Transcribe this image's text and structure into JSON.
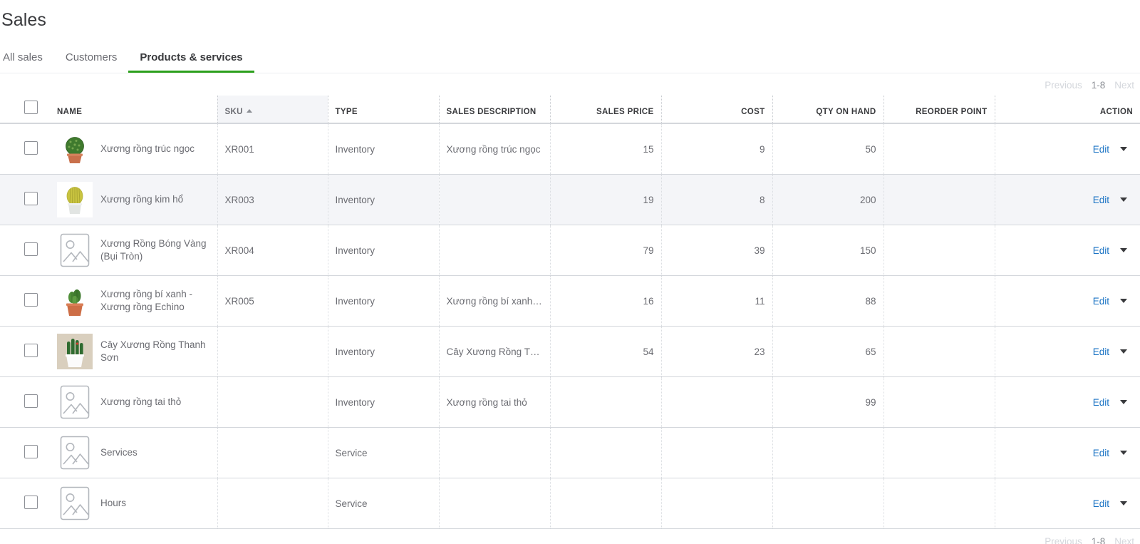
{
  "page": {
    "title": "Sales"
  },
  "tabs": [
    {
      "label": "All sales",
      "active": false
    },
    {
      "label": "Customers",
      "active": false
    },
    {
      "label": "Products & services",
      "active": true
    }
  ],
  "pagination": {
    "previous": "Previous",
    "range": "1-8",
    "next": "Next"
  },
  "colors": {
    "accent_green": "#2ca01c",
    "link_blue": "#1a73c4",
    "selected_row": "#f4f5f8",
    "text": "#393a3d",
    "muted": "#6b6c72"
  },
  "table": {
    "columns": [
      {
        "key": "checkbox",
        "label": ""
      },
      {
        "key": "name",
        "label": "NAME"
      },
      {
        "key": "sku",
        "label": "SKU",
        "sorted": "asc"
      },
      {
        "key": "type",
        "label": "TYPE"
      },
      {
        "key": "description",
        "label": "SALES DESCRIPTION"
      },
      {
        "key": "price",
        "label": "SALES PRICE"
      },
      {
        "key": "cost",
        "label": "COST"
      },
      {
        "key": "qty",
        "label": "QTY ON HAND"
      },
      {
        "key": "reorder",
        "label": "REORDER POINT"
      },
      {
        "key": "action",
        "label": "ACTION"
      }
    ],
    "action_label": "Edit",
    "rows": [
      {
        "name": "Xương rồng trúc ngọc",
        "sku": "XR001",
        "type": "Inventory",
        "description": "Xương rồng trúc ngọc",
        "price": "15",
        "cost": "9",
        "qty": "50",
        "reorder": "",
        "thumb": "cactus-round-terracotta",
        "selected": false
      },
      {
        "name": "Xương rồng kim hổ",
        "sku": "XR003",
        "type": "Inventory",
        "description": "",
        "price": "19",
        "cost": "8",
        "qty": "200",
        "reorder": "",
        "thumb": "cactus-barrel-white",
        "selected": true
      },
      {
        "name": "Xương Rồng Bóng Vàng (Bụi Tròn)",
        "sku": "XR004",
        "type": "Inventory",
        "description": "",
        "price": "79",
        "cost": "39",
        "qty": "150",
        "reorder": "",
        "thumb": "image-placeholder",
        "selected": false
      },
      {
        "name": "Xương rồng bí xanh - Xương rồng Echino",
        "sku": "XR005",
        "type": "Inventory",
        "description": "Xương rồng bí xanh - …",
        "price": "16",
        "cost": "11",
        "qty": "88",
        "reorder": "",
        "thumb": "cactus-cluster-terracotta",
        "selected": false
      },
      {
        "name": "Cây Xương Rồng Thanh Sơn",
        "sku": "",
        "type": "Inventory",
        "description": "Cây Xương Rồng Than…",
        "price": "54",
        "cost": "23",
        "qty": "65",
        "reorder": "",
        "thumb": "cactus-tall-white",
        "selected": false
      },
      {
        "name": "Xương rồng tai thỏ",
        "sku": "",
        "type": "Inventory",
        "description": "Xương rồng tai thỏ",
        "price": "",
        "cost": "",
        "qty": "99",
        "reorder": "",
        "thumb": "image-placeholder",
        "selected": false
      },
      {
        "name": "Services",
        "sku": "",
        "type": "Service",
        "description": "",
        "price": "",
        "cost": "",
        "qty": "",
        "reorder": "",
        "thumb": "image-placeholder",
        "selected": false
      },
      {
        "name": "Hours",
        "sku": "",
        "type": "Service",
        "description": "",
        "price": "",
        "cost": "",
        "qty": "",
        "reorder": "",
        "thumb": "image-placeholder",
        "selected": false
      }
    ]
  }
}
